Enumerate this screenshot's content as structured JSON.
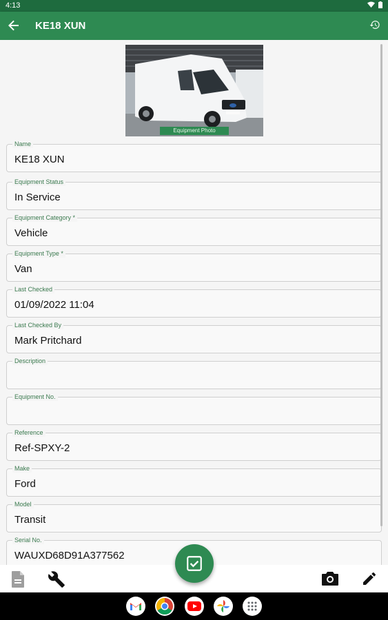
{
  "status_bar": {
    "time": "4:13"
  },
  "app_bar": {
    "title": "KE18 XUN"
  },
  "photo": {
    "caption": "Equipment Photo"
  },
  "fields": [
    {
      "label": "Name",
      "value": "KE18 XUN"
    },
    {
      "label": "Equipment Status",
      "value": "In Service"
    },
    {
      "label": "Equipment Category *",
      "value": "Vehicle"
    },
    {
      "label": "Equipment Type *",
      "value": "Van"
    },
    {
      "label": "Last Checked",
      "value": "01/09/2022 11:04"
    },
    {
      "label": "Last Checked By",
      "value": "Mark Pritchard"
    },
    {
      "label": "Description",
      "value": ""
    },
    {
      "label": "Equipment No.",
      "value": ""
    },
    {
      "label": "Reference",
      "value": "Ref-SPXY-2"
    },
    {
      "label": "Make",
      "value": "Ford"
    },
    {
      "label": "Model",
      "value": "Transit"
    },
    {
      "label": "Serial No.",
      "value": "WAUXD68D91A377562"
    }
  ],
  "colors": {
    "primary": "#2e8a52",
    "status_bar": "#1e6b3e",
    "label": "#3b7a4f"
  },
  "icons": {
    "back": "arrow-left-icon",
    "history": "history-icon",
    "document": "document-icon",
    "wrench": "wrench-icon",
    "camera": "camera-icon",
    "edit": "pencil-icon",
    "check": "checkbox-check-icon"
  },
  "dock": [
    "Gmail",
    "Chrome",
    "YouTube",
    "Photos",
    "Apps"
  ]
}
